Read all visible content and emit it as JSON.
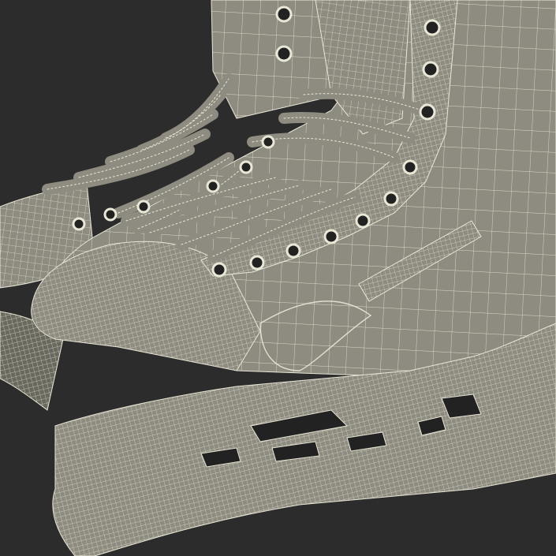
{
  "scene": {
    "subject": "hockey-skates-wireframe",
    "background_color": "#2c2c2c",
    "surface_color": "#8e8c80",
    "surface_shadow_color": "#6a695f",
    "wire_color": "#e9e7d6",
    "hole_color": "#222222"
  }
}
